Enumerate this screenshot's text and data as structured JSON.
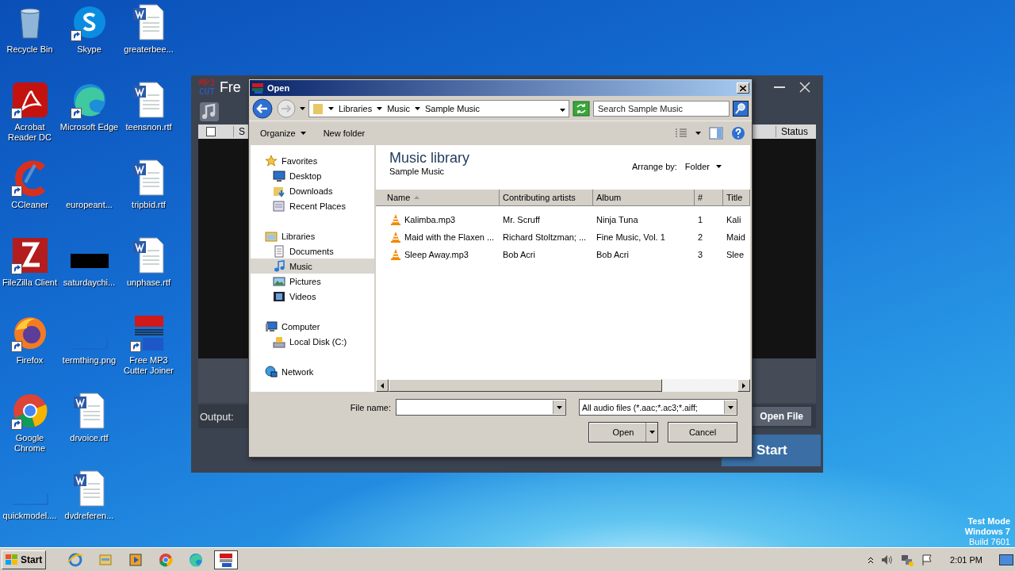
{
  "desktop_icons": [
    {
      "label": "Recycle Bin",
      "kind": "recycle",
      "shortcut": false
    },
    {
      "label": "Acrobat Reader DC",
      "kind": "acrobat",
      "shortcut": true
    },
    {
      "label": "CCleaner",
      "kind": "ccleaner",
      "shortcut": true
    },
    {
      "label": "FileZilla Client",
      "kind": "filezilla",
      "shortcut": true
    },
    {
      "label": "Firefox",
      "kind": "firefox",
      "shortcut": true
    },
    {
      "label": "Google Chrome",
      "kind": "chrome",
      "shortcut": true
    },
    {
      "label": "quickmodel....",
      "kind": "blank",
      "shortcut": false
    },
    {
      "label": "Skype",
      "kind": "skype",
      "shortcut": true
    },
    {
      "label": "Microsoft Edge",
      "kind": "edge",
      "shortcut": true
    },
    {
      "label": "europeant...",
      "kind": "blank",
      "shortcut": false
    },
    {
      "label": "saturdaychi...",
      "kind": "dark",
      "shortcut": false
    },
    {
      "label": "termthing.png",
      "kind": "blank",
      "shortcut": false
    },
    {
      "label": "drvoice.rtf",
      "kind": "word",
      "shortcut": false
    },
    {
      "label": "dvdreferen...",
      "kind": "word",
      "shortcut": false
    },
    {
      "label": "greaterbee...",
      "kind": "word",
      "shortcut": false
    },
    {
      "label": "teensnon.rtf",
      "kind": "word",
      "shortcut": false
    },
    {
      "label": "tripbid.rtf",
      "kind": "word",
      "shortcut": false
    },
    {
      "label": "unphase.rtf",
      "kind": "word",
      "shortcut": false
    },
    {
      "label": "Free MP3 Cutter Joiner",
      "kind": "mp3cut",
      "shortcut": true
    }
  ],
  "app": {
    "title": "Fre",
    "select_all": {
      "checked": false
    },
    "logo_top": "MP3",
    "logo_bottom": "CUT",
    "columns": [
      "S",
      "Status"
    ],
    "output_label": "Output:",
    "open_file": "Open File",
    "start": "Start"
  },
  "dialog": {
    "title": "Open",
    "breadcrumb": [
      "Libraries",
      "Music",
      "Sample Music"
    ],
    "search": {
      "placeholder": "Search Sample Music"
    },
    "toolbar": [
      "Organize",
      "New folder"
    ],
    "nav": [
      {
        "label": "Favorites",
        "kind": "star",
        "selected": false,
        "children": [
          {
            "label": "Desktop",
            "kind": "desktop",
            "selected": false
          },
          {
            "label": "Downloads",
            "kind": "downloads",
            "selected": false
          },
          {
            "label": "Recent Places",
            "kind": "recent",
            "selected": false
          }
        ]
      },
      {
        "label": "Libraries",
        "kind": "library",
        "selected": false,
        "children": [
          {
            "label": "Documents",
            "kind": "documents",
            "selected": false
          },
          {
            "label": "Music",
            "kind": "music",
            "selected": true
          },
          {
            "label": "Pictures",
            "kind": "pictures",
            "selected": false
          },
          {
            "label": "Videos",
            "kind": "videos",
            "selected": false
          }
        ]
      },
      {
        "label": "Computer",
        "kind": "computer",
        "selected": false,
        "children": [
          {
            "label": "Local Disk (C:)",
            "kind": "disk",
            "selected": false
          }
        ]
      },
      {
        "label": "Network",
        "kind": "network",
        "selected": false
      }
    ],
    "library_title": "Music library",
    "library_subtitle": "Sample Music",
    "arrange_label": "Arrange by:",
    "arrange_value": "Folder",
    "columns": [
      {
        "label": "Name",
        "sorted": true
      },
      {
        "label": "Contributing artists",
        "sorted": false
      },
      {
        "label": "Album",
        "sorted": false
      },
      {
        "label": "#",
        "sorted": false
      },
      {
        "label": "Title",
        "sorted": false
      }
    ],
    "rows": [
      {
        "cells": [
          "Kalimba.mp3",
          "Mr. Scruff",
          "Ninja Tuna",
          "1",
          "Kali"
        ],
        "selected": false
      },
      {
        "cells": [
          "Maid with the Flaxen ...",
          "Richard Stoltzman; ...",
          "Fine Music, Vol. 1",
          "2",
          "Maid"
        ],
        "selected": false
      },
      {
        "cells": [
          "Sleep Away.mp3",
          "Bob Acri",
          "Bob Acri",
          "3",
          "Slee"
        ],
        "selected": false
      }
    ],
    "file_name_label": "File name:",
    "filter": "All audio files (*.aac;*.ac3;*.aiff;",
    "buttons": [
      "Open",
      "Cancel"
    ]
  },
  "taskbar": {
    "start": "Start",
    "apps": [
      {
        "kind": "ie",
        "selected": false
      },
      {
        "kind": "explorer",
        "selected": false
      },
      {
        "kind": "media",
        "selected": false
      },
      {
        "kind": "chrome",
        "selected": false
      },
      {
        "kind": "edge",
        "selected": false
      },
      {
        "kind": "mp3cut",
        "selected": true
      }
    ],
    "time": "2:01 PM"
  },
  "os_notice": [
    "Test Mode",
    "Windows 7",
    "Build 7601"
  ]
}
